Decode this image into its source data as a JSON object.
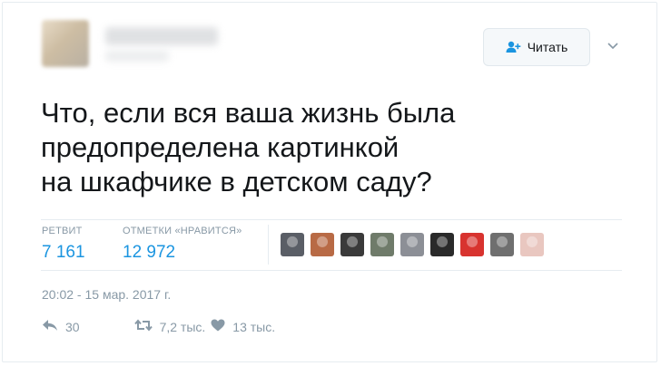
{
  "follow_button": {
    "label": "Читать",
    "icon": "follow-icon"
  },
  "tweet": {
    "lines": [
      "Что, если вся ваша жизнь была",
      "предопределена картинкой",
      "на шкафчике в детском саду?"
    ]
  },
  "stats": {
    "retweets": {
      "label": "РЕТВИТ",
      "value": "7 161"
    },
    "likes": {
      "label": "ОТМЕТКИ «НРАВИТСЯ»",
      "value": "12 972"
    }
  },
  "liker_avatars": [
    {
      "color": "#5a5e66"
    },
    {
      "color": "#b86a45"
    },
    {
      "color": "#3a3a3a"
    },
    {
      "color": "#6f7b6a"
    },
    {
      "color": "#8c8f96"
    },
    {
      "color": "#2a2a2a"
    },
    {
      "color": "#d8332f"
    },
    {
      "color": "#6f6f6f"
    },
    {
      "color": "#e9c7c0"
    }
  ],
  "timestamp": "20:02 - 15 мар. 2017 г.",
  "actions": {
    "reply_count": "30",
    "retweet_count": "7,2 тыс.",
    "like_count": "13 тыс."
  },
  "colors": {
    "accent": "#1b95e0",
    "muted": "#8899a6",
    "text": "#14171a",
    "border": "#e6ecf0"
  }
}
